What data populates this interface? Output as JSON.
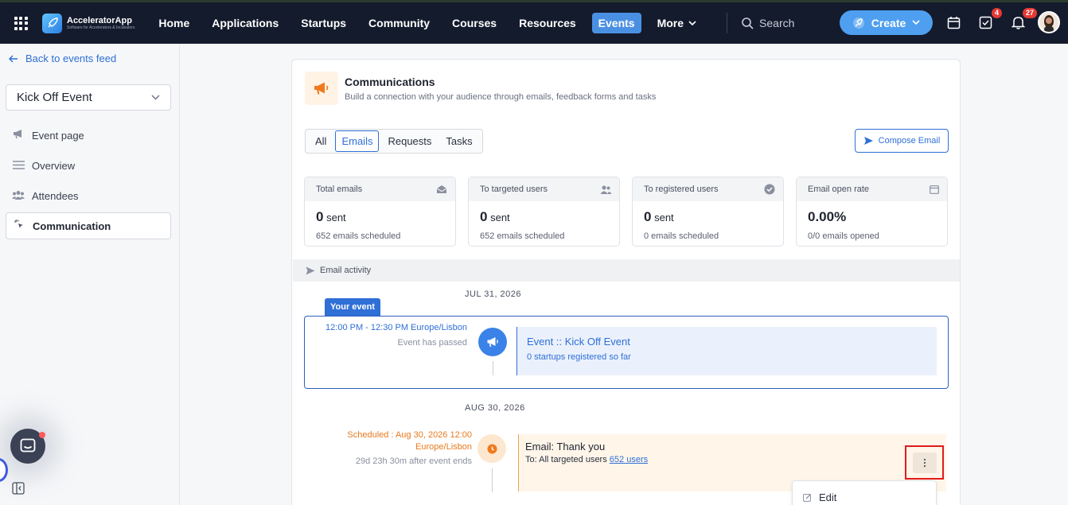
{
  "nav": {
    "app_name": "AcceleratorApp",
    "app_tagline": "Software for Accelerators & Incubators",
    "items": [
      "Home",
      "Applications",
      "Startups",
      "Community",
      "Courses",
      "Resources",
      "Events"
    ],
    "active": "Events",
    "more_label": "More",
    "search_label": "Search",
    "create_label": "Create",
    "tasks_badge": "4",
    "notifications_badge": "27"
  },
  "sidebar": {
    "back_label": "Back to events feed",
    "event_selector": "Kick Off Event",
    "items": [
      {
        "label": "Event page",
        "icon": "megaphone-icon"
      },
      {
        "label": "Overview",
        "icon": "list-icon"
      },
      {
        "label": "Attendees",
        "icon": "users-icon"
      },
      {
        "label": "Communication",
        "icon": "sparkle-cursor-icon"
      }
    ],
    "active": "Communication"
  },
  "main": {
    "title": "Communications",
    "subtitle": "Build a connection with your audience through emails, feedback forms and tasks",
    "tabs": [
      "All",
      "Emails",
      "Requests",
      "Tasks"
    ],
    "active_tab": "Emails",
    "compose_label": "Compose Email",
    "stats": [
      {
        "label": "Total emails",
        "value": "0",
        "unit": "sent",
        "footer": "652 emails scheduled",
        "icon": "inbox-icon"
      },
      {
        "label": "To targeted users",
        "value": "0",
        "unit": "sent",
        "footer": "652 emails scheduled",
        "icon": "users-icon"
      },
      {
        "label": "To registered users",
        "value": "0",
        "unit": "sent",
        "footer": "0 emails scheduled",
        "icon": "check-circle-icon"
      },
      {
        "label": "Email open rate",
        "value": "0.00%",
        "unit": "",
        "footer": "0/0 emails opened",
        "icon": "calendar-icon"
      }
    ],
    "activity_label": "Email activity",
    "timeline": {
      "date1": "JUL 31, 2026",
      "your_event_label": "Your event",
      "event_time": "12:00 PM - 12:30 PM Europe/Lisbon",
      "event_status": "Event has passed",
      "event_title": "Event :: Kick Off Event",
      "event_sub": "0 startups registered so far",
      "date2": "AUG 30, 2026",
      "sched_line1": "Scheduled : Aug 30, 2026 12:00",
      "sched_line2": "Europe/Lisbon",
      "sched_relative": "29d 23h 30m after event ends",
      "email_title": "Email: Thank you",
      "email_to_prefix": "To: All targeted users",
      "email_to_link": "652 users",
      "menu_edit": "Edit"
    }
  },
  "colors": {
    "nav_bg": "#141b2d",
    "accent": "#2f6fd6",
    "create": "#4e9ff0",
    "scheduled": "#e8791e",
    "highlight": "#e11b1b"
  }
}
